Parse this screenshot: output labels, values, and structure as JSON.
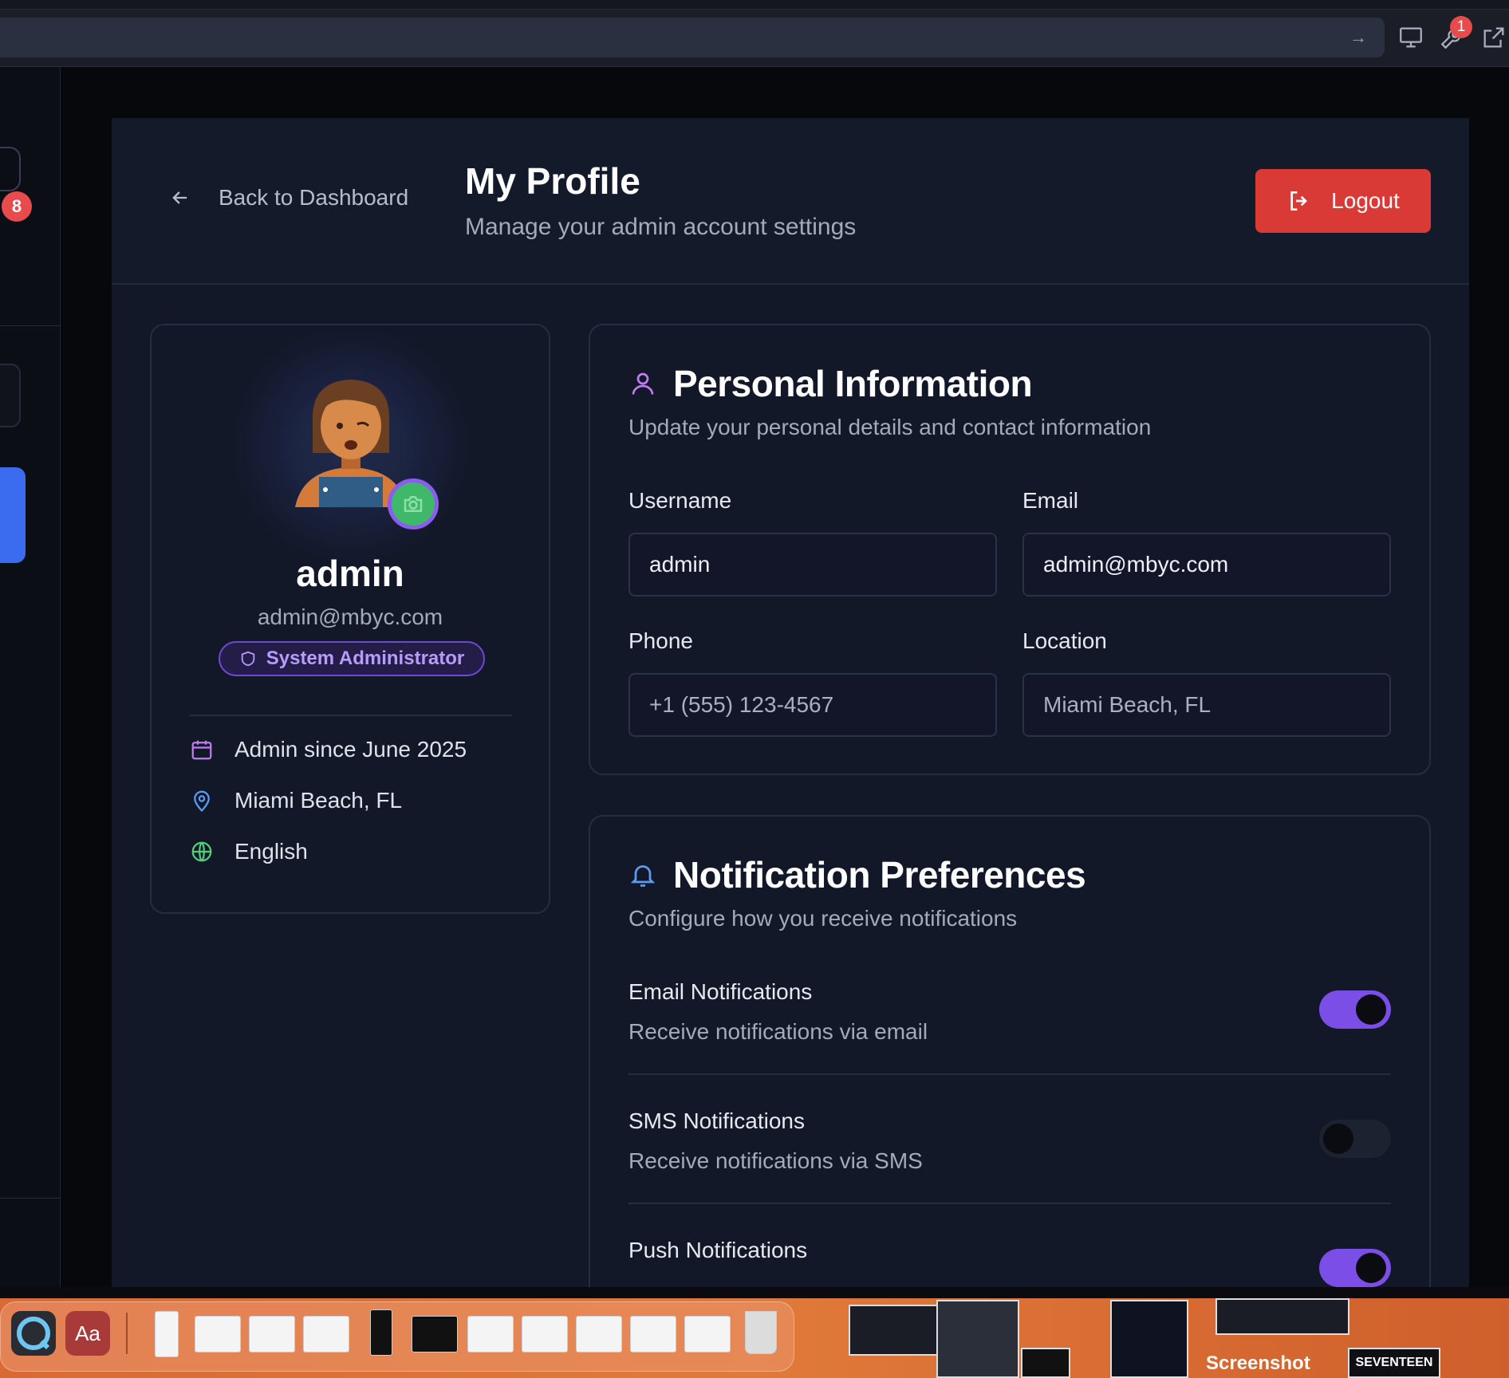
{
  "browser": {
    "forward_icon": "arrow-right-icon",
    "extension_badge": "1"
  },
  "sidebar": {
    "badge_count": "8"
  },
  "header": {
    "back_label": "Back to Dashboard",
    "title": "My Profile",
    "subtitle": "Manage your admin account settings",
    "logout_label": "Logout"
  },
  "profile": {
    "name": "admin",
    "email": "admin@mbyc.com",
    "role": "System Administrator",
    "meta": [
      {
        "icon": "calendar-icon",
        "text": "Admin since June 2025",
        "color": "#c27cf0"
      },
      {
        "icon": "map-pin-icon",
        "text": "Miami Beach, FL",
        "color": "#5b9df5"
      },
      {
        "icon": "globe-icon",
        "text": "English",
        "color": "#4fcf7a"
      }
    ]
  },
  "personal": {
    "title": "Personal Information",
    "subtitle": "Update your personal details and contact information",
    "username_label": "Username",
    "username_value": "admin",
    "email_label": "Email",
    "email_value": "admin@mbyc.com",
    "phone_label": "Phone",
    "phone_placeholder": "+1 (555) 123-4567",
    "location_label": "Location",
    "location_placeholder": "Miami Beach, FL"
  },
  "notifications": {
    "title": "Notification Preferences",
    "subtitle": "Configure how you receive notifications",
    "items": [
      {
        "title": "Email Notifications",
        "desc": "Receive notifications via email",
        "enabled": true
      },
      {
        "title": "SMS Notifications",
        "desc": "Receive notifications via SMS",
        "enabled": false
      },
      {
        "title": "Push Notifications",
        "desc": "",
        "enabled": true
      }
    ]
  },
  "dock": {
    "dictionary_label": "Aa",
    "screenshot_label": "Screenshot",
    "thumbnail_label": "SEVENTEEN"
  },
  "colors": {
    "accent": "#7c4ee8",
    "danger": "#d93a35",
    "panel": "#121827"
  }
}
